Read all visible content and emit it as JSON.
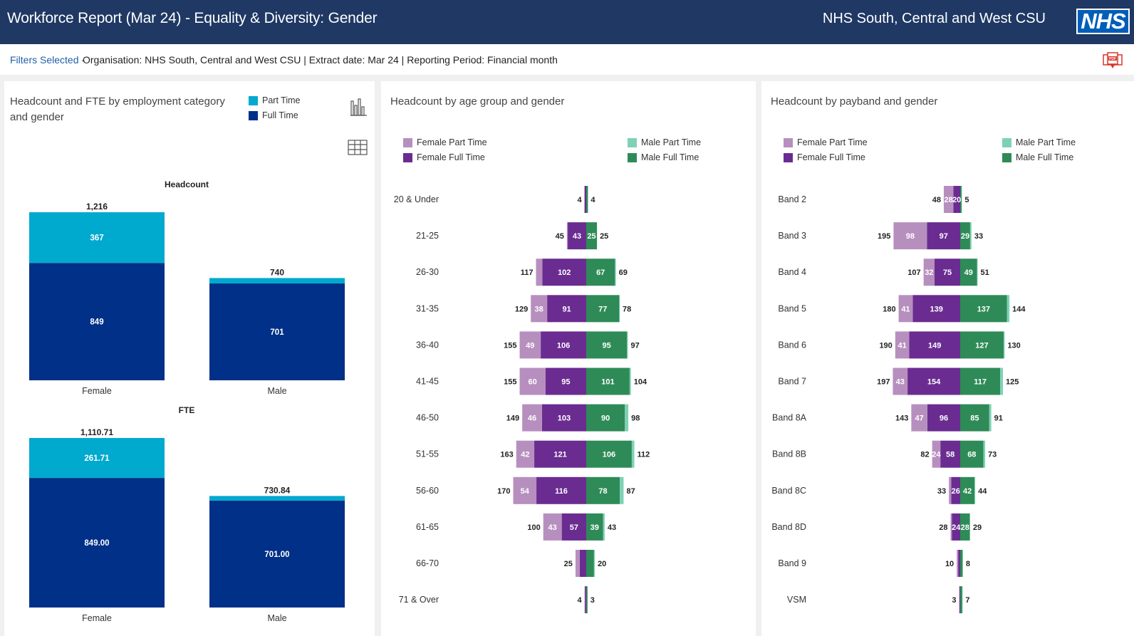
{
  "header": {
    "title": "Workforce Report (Mar 24) - Equality & Diversity: Gender",
    "org": "NHS South, Central and West CSU",
    "logo": "NHS"
  },
  "filters": {
    "label": "Filters Selected -",
    "text": "Organisation: NHS South, Central and West CSU | Extract date: Mar 24 | Reporting Period: Financial month",
    "pdf_icon": "pdf-export-icon"
  },
  "colors": {
    "part_time": "#00a9ce",
    "full_time": "#003087",
    "female_part": "#b78fbf",
    "female_full": "#6a2c91",
    "male_part": "#7fd1b5",
    "male_full": "#2e8b57"
  },
  "panel1": {
    "title_line1": "Headcount and FTE by employment category",
    "title_line2": "and gender",
    "legend": [
      "Part Time",
      "Full Time"
    ],
    "chart_icon": "bar-chart-icon",
    "table_icon": "table-icon"
  },
  "panel2": {
    "title": "Headcount by age group and gender",
    "legend": [
      "Female Part Time",
      "Female Full Time",
      "Male Part Time",
      "Male Full Time"
    ]
  },
  "panel3": {
    "title": "Headcount by payband and gender",
    "legend": [
      "Female Part Time",
      "Female Full Time",
      "Male Part Time",
      "Male Full Time"
    ]
  },
  "chart_data": [
    {
      "type": "bar",
      "title": "Headcount",
      "categories": [
        "Female",
        "Male"
      ],
      "series": [
        {
          "name": "Part Time",
          "values": [
            367,
            39
          ]
        },
        {
          "name": "Full Time",
          "values": [
            849,
            701
          ]
        }
      ],
      "totals": [
        "1,216",
        "740"
      ],
      "labels": {
        "part": [
          "367",
          ""
        ],
        "full": [
          "849",
          "701"
        ]
      }
    },
    {
      "type": "bar",
      "title": "FTE",
      "categories": [
        "Female",
        "Male"
      ],
      "series": [
        {
          "name": "Part Time",
          "values": [
            261.71,
            29.84
          ]
        },
        {
          "name": "Full Time",
          "values": [
            849.0,
            701.0
          ]
        }
      ],
      "totals": [
        "1,110.71",
        "730.84"
      ],
      "labels": {
        "part": [
          "261.71",
          ""
        ],
        "full": [
          "849.00",
          "701.00"
        ]
      }
    },
    {
      "type": "bar",
      "title": "Headcount by age group and gender",
      "categories": [
        "20 & Under",
        "21-25",
        "26-30",
        "31-35",
        "36-40",
        "41-45",
        "46-50",
        "51-55",
        "56-60",
        "61-65",
        "66-70",
        "71 & Over"
      ],
      "series": [
        {
          "name": "Female Part Time",
          "values": [
            0,
            2,
            15,
            38,
            49,
            60,
            46,
            42,
            54,
            43,
            10,
            1
          ]
        },
        {
          "name": "Female Full Time",
          "values": [
            4,
            43,
            102,
            91,
            106,
            95,
            103,
            121,
            116,
            57,
            15,
            3
          ]
        },
        {
          "name": "Male Part Time",
          "values": [
            0,
            0,
            2,
            1,
            2,
            3,
            8,
            6,
            9,
            4,
            2,
            0
          ]
        },
        {
          "name": "Male Full Time",
          "values": [
            4,
            25,
            67,
            77,
            95,
            101,
            90,
            106,
            78,
            39,
            18,
            3
          ]
        }
      ],
      "female_totals": [
        4,
        45,
        117,
        129,
        155,
        155,
        149,
        163,
        170,
        100,
        25,
        4
      ],
      "male_totals": [
        4,
        25,
        69,
        78,
        97,
        104,
        98,
        112,
        87,
        43,
        20,
        3
      ],
      "labels": {
        "fp": [
          "",
          "",
          "",
          "38",
          "49",
          "60",
          "46",
          "42",
          "54",
          "43",
          "",
          ""
        ],
        "ff": [
          "",
          "43",
          "102",
          "91",
          "106",
          "95",
          "103",
          "121",
          "116",
          "57",
          "",
          ""
        ],
        "mp": [
          "",
          "",
          "",
          "",
          "",
          "",
          "",
          "",
          "",
          "",
          "",
          ""
        ],
        "mf": [
          "",
          "25",
          "67",
          "77",
          "95",
          "101",
          "90",
          "106",
          "78",
          "39",
          "",
          ""
        ]
      }
    },
    {
      "type": "bar",
      "title": "Headcount by payband and gender",
      "categories": [
        "Band 2",
        "Band 3",
        "Band 4",
        "Band 5",
        "Band 6",
        "Band 7",
        "Band 8A",
        "Band 8B",
        "Band 8C",
        "Band 8D",
        "Band 9",
        "VSM"
      ],
      "series": [
        {
          "name": "Female Part Time",
          "values": [
            28,
            98,
            32,
            41,
            41,
            43,
            47,
            24,
            7,
            4,
            4,
            1
          ]
        },
        {
          "name": "Female Full Time",
          "values": [
            20,
            97,
            75,
            139,
            149,
            154,
            96,
            58,
            26,
            24,
            6,
            2
          ]
        },
        {
          "name": "Male Part Time",
          "values": [
            1,
            4,
            2,
            7,
            3,
            8,
            6,
            5,
            2,
            1,
            1,
            1
          ]
        },
        {
          "name": "Male Full Time",
          "values": [
            4,
            29,
            49,
            137,
            127,
            117,
            85,
            68,
            42,
            28,
            7,
            6
          ]
        }
      ],
      "female_totals": [
        48,
        195,
        107,
        180,
        190,
        197,
        143,
        82,
        33,
        28,
        10,
        3
      ],
      "male_totals": [
        5,
        33,
        51,
        144,
        130,
        125,
        91,
        73,
        44,
        29,
        8,
        7
      ],
      "labels": {
        "fp": [
          "28",
          "98",
          "32",
          "41",
          "41",
          "43",
          "47",
          "24",
          "",
          "",
          "",
          ""
        ],
        "ff": [
          "20",
          "97",
          "75",
          "139",
          "149",
          "154",
          "96",
          "58",
          "26",
          "24",
          "",
          ""
        ],
        "mp": [
          "",
          "",
          "",
          "",
          "",
          "",
          "",
          "",
          "",
          "",
          "",
          ""
        ],
        "mf": [
          "",
          "29",
          "49",
          "137",
          "127",
          "117",
          "85",
          "68",
          "42",
          "28",
          "",
          ""
        ]
      }
    }
  ]
}
